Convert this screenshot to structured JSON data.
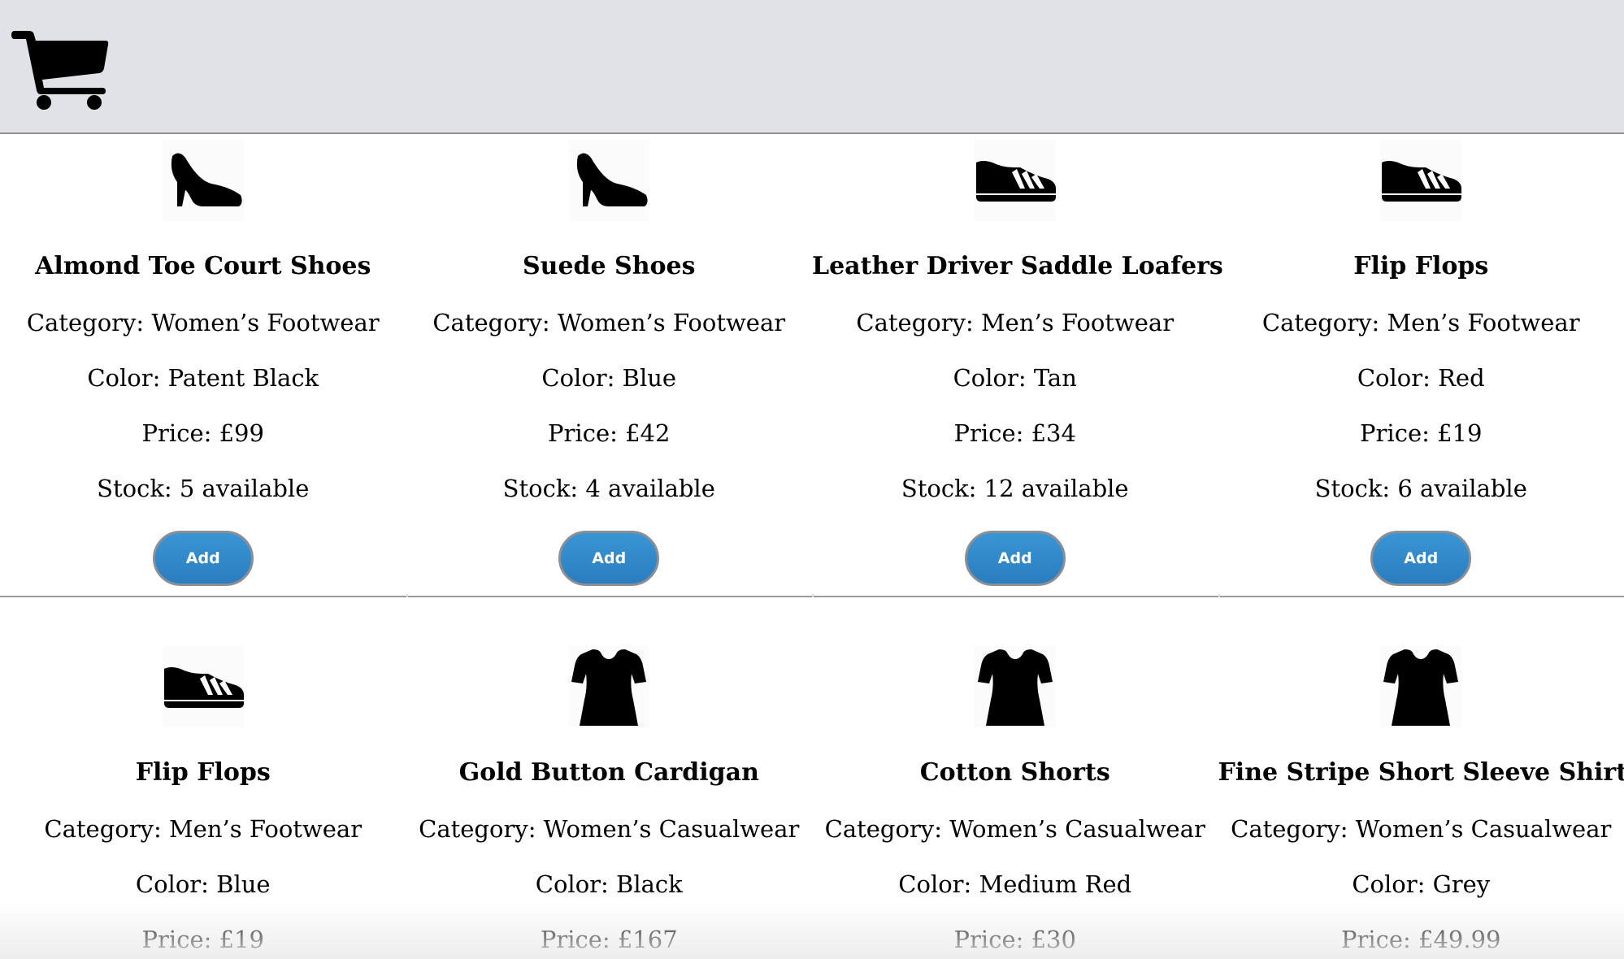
{
  "header": {
    "cart_icon": "shopping-cart-icon"
  },
  "products": [
    {
      "icon": "high-heel-shoe-icon",
      "name": "Almond Toe Court Shoes",
      "category": "Category: Women’s Footwear",
      "color": "Color: Patent Black",
      "price": "Price: £99",
      "stock": "Stock: 5 available",
      "button": "Add"
    },
    {
      "icon": "high-heel-shoe-icon",
      "name": "Suede Shoes",
      "category": "Category: Women’s Footwear",
      "color": "Color: Blue",
      "price": "Price: £42",
      "stock": "Stock: 4 available",
      "button": "Add"
    },
    {
      "icon": "sneaker-icon",
      "name": "Leather Driver Saddle Loafers",
      "category": "Category: Men’s Footwear",
      "color": "Color: Tan",
      "price": "Price: £34",
      "stock": "Stock: 12 available",
      "button": "Add"
    },
    {
      "icon": "sneaker-icon",
      "name": "Flip Flops",
      "category": "Category: Men’s Footwear",
      "color": "Color: Red",
      "price": "Price: £19",
      "stock": "Stock: 6 available",
      "button": "Add"
    },
    {
      "icon": "sneaker-icon",
      "name": "Flip Flops",
      "category": "Category: Men’s Footwear",
      "color": "Color: Blue",
      "price": "Price: £19"
    },
    {
      "icon": "tshirt-icon",
      "name": "Gold Button Cardigan",
      "category": "Category: Women’s Casualwear",
      "color": "Color: Black",
      "price": "Price: £167"
    },
    {
      "icon": "tshirt-icon",
      "name": "Cotton Shorts",
      "category": "Category: Women’s Casualwear",
      "color": "Color: Medium Red",
      "price": "Price: £30"
    },
    {
      "icon": "tshirt-icon",
      "name": "Fine Stripe Short Sleeve Shirt",
      "category": "Category: Women’s Casualwear",
      "color": "Color: Grey",
      "price": "Price: £49.99"
    }
  ]
}
